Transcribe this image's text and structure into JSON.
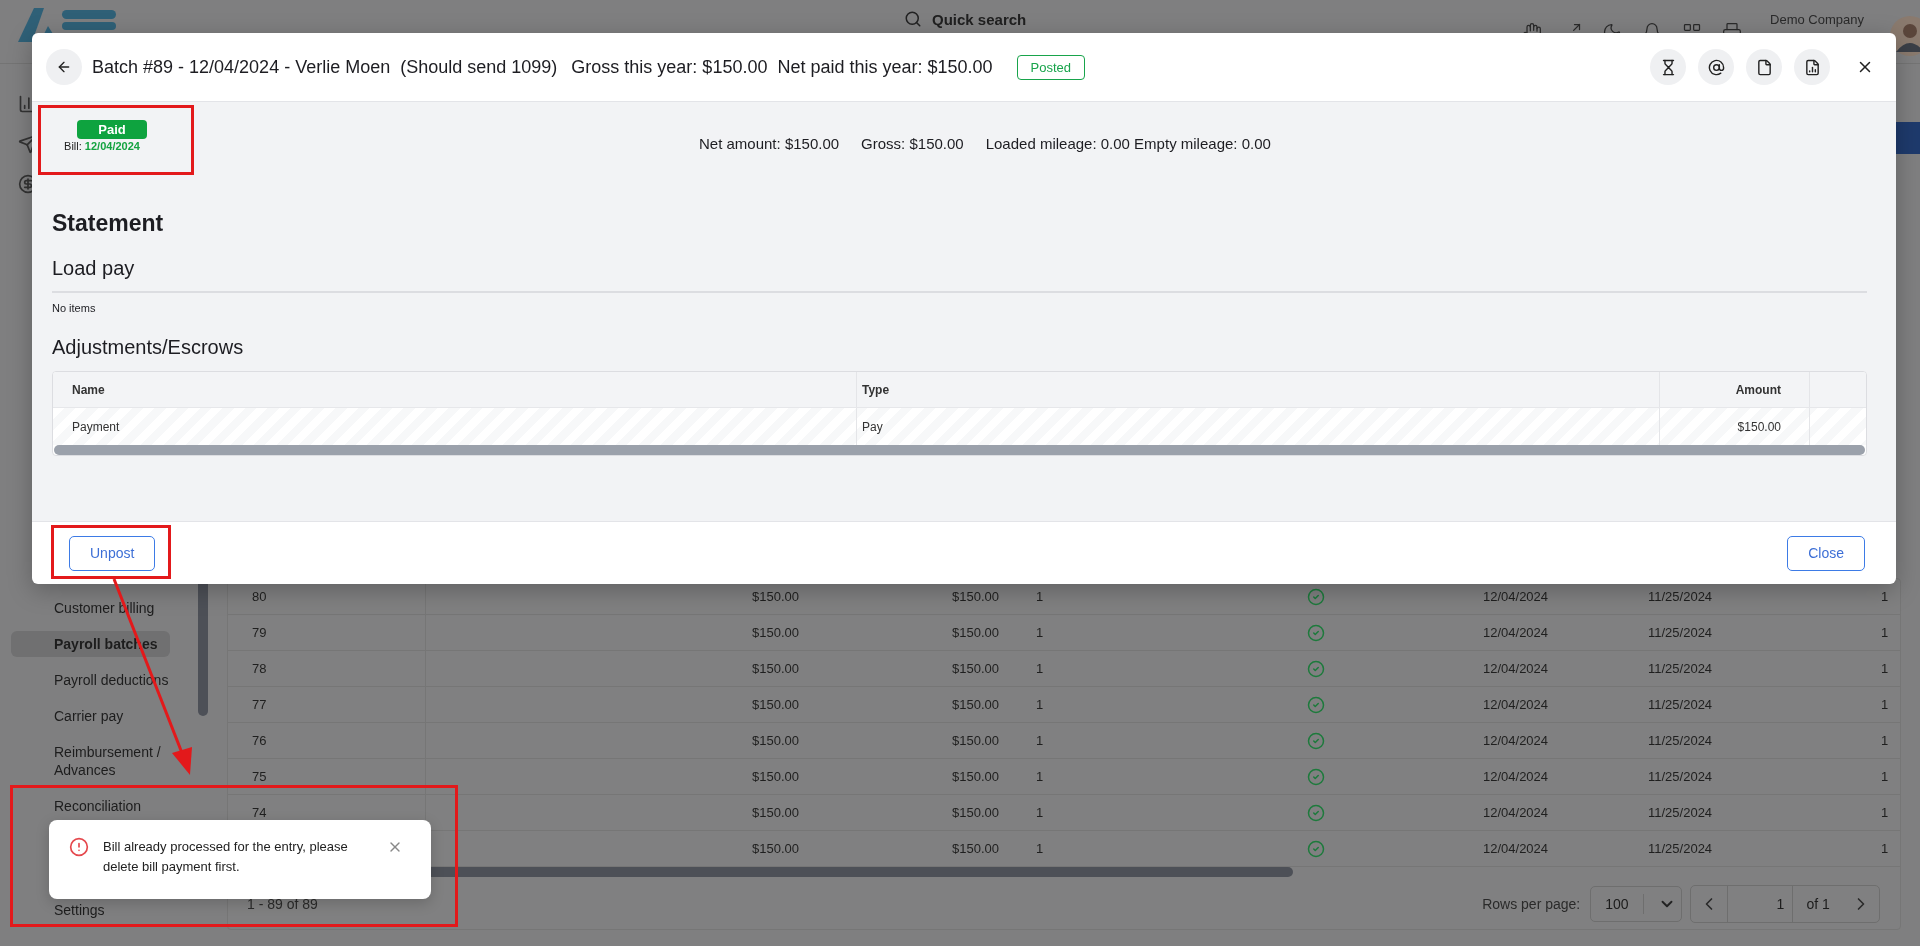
{
  "header": {
    "search_label": "Quick search",
    "company": "Demo Company"
  },
  "sidebar": {
    "items": [
      {
        "label": "Customer billing",
        "selected": false
      },
      {
        "label": "Payroll batches",
        "selected": true
      },
      {
        "label": "Payroll deductions",
        "selected": false
      },
      {
        "label": "Carrier pay",
        "selected": false
      },
      {
        "label": "Reimbursement / Advances",
        "selected": false
      },
      {
        "label": "Reconciliation",
        "selected": false
      }
    ],
    "bottom_item": {
      "label": "Settings",
      "selected": false
    }
  },
  "table": {
    "rows": [
      {
        "column_1": "80",
        "column_2": "$150.00",
        "column_3": "$150.00",
        "column_4": "1",
        "posted": true,
        "column_6": "12/04/2024",
        "column_7": "11/25/2024",
        "column_8": "1"
      },
      {
        "column_1": "79",
        "column_2": "$150.00",
        "column_3": "$150.00",
        "column_4": "1",
        "posted": true,
        "column_6": "12/04/2024",
        "column_7": "11/25/2024",
        "column_8": "1"
      },
      {
        "column_1": "78",
        "column_2": "$150.00",
        "column_3": "$150.00",
        "column_4": "1",
        "posted": true,
        "column_6": "12/04/2024",
        "column_7": "11/25/2024",
        "column_8": "1"
      },
      {
        "column_1": "77",
        "column_2": "$150.00",
        "column_3": "$150.00",
        "column_4": "1",
        "posted": true,
        "column_6": "12/04/2024",
        "column_7": "11/25/2024",
        "column_8": "1"
      },
      {
        "column_1": "76",
        "column_2": "$150.00",
        "column_3": "$150.00",
        "column_4": "1",
        "posted": true,
        "column_6": "12/04/2024",
        "column_7": "11/25/2024",
        "column_8": "1"
      },
      {
        "column_1": "75",
        "column_2": "$150.00",
        "column_3": "$150.00",
        "column_4": "1",
        "posted": true,
        "column_6": "12/04/2024",
        "column_7": "11/25/2024",
        "column_8": "1"
      },
      {
        "column_1": "74",
        "column_2": "$150.00",
        "column_3": "$150.00",
        "column_4": "1",
        "posted": true,
        "column_6": "12/04/2024",
        "column_7": "11/25/2024",
        "column_8": "1"
      },
      {
        "column_2": "$150.00",
        "column_3": "$150.00",
        "column_4": "1",
        "posted": true,
        "column_6": "12/04/2024",
        "column_7": "11/25/2024",
        "column_8": "1"
      }
    ],
    "footer": {
      "range": "1 - 89 of 89",
      "rows_per_page_label": "Rows per page:",
      "rows_per_page": "100",
      "page": "1",
      "page_count": "of 1"
    }
  },
  "modal": {
    "title": "Batch #89 - 12/04/2024 - Verlie Moen",
    "note": "(Should send 1099)",
    "gross_year": "Gross this year: $150.00",
    "net_year": "Net paid this year: $150.00",
    "status": "Posted",
    "paid_badge": "Paid",
    "bill_label": "Bill:",
    "bill_date": "12/04/2024",
    "summary": [
      "Net amount: $150.00",
      "Gross: $150.00",
      "Loaded mileage: 0.00 Empty mileage: 0.00"
    ],
    "statement_title": "Statement",
    "load_pay": {
      "title": "Load pay",
      "empty": "No items"
    },
    "adjustments": {
      "title": "Adjustments/Escrows",
      "columns": [
        "Name",
        "Type",
        "Amount"
      ],
      "rows": [
        {
          "name": "Payment",
          "type": "Pay",
          "amount": "$150.00"
        }
      ]
    },
    "buttons": {
      "unpost": "Unpost",
      "close": "Close"
    }
  },
  "toast": {
    "kind": "error",
    "message": "Bill already processed for the entry, please delete bill payment first."
  }
}
